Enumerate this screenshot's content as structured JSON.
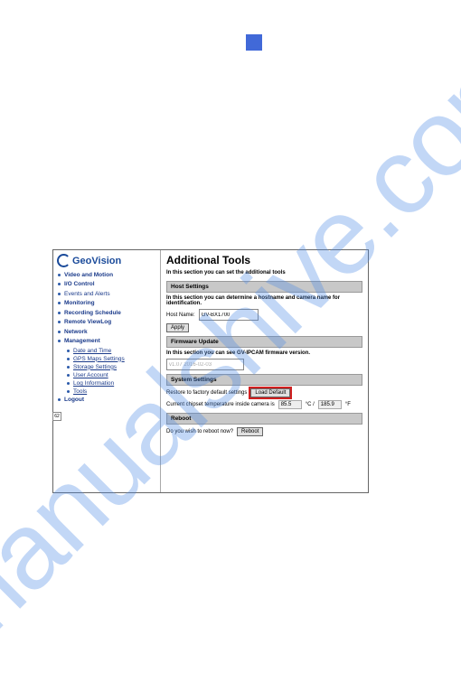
{
  "watermark": "manualshive.com",
  "page_num": "",
  "screenshot": {
    "logo": "GeoVision",
    "nav": [
      {
        "label": "Video and Motion",
        "bold": true
      },
      {
        "label": "I/O Control",
        "bold": true
      },
      {
        "label": "Events and Alerts",
        "bold": false
      },
      {
        "label": "Monitoring",
        "bold": true
      },
      {
        "label": "Recording Schedule",
        "bold": true
      },
      {
        "label": "Remote ViewLog",
        "bold": true
      },
      {
        "label": "Network",
        "bold": true
      },
      {
        "label": "Management",
        "bold": true
      }
    ],
    "subnav": [
      "Date and Time",
      "GPS Maps Settings",
      "Storage Settings",
      "User Account",
      "Log Information",
      "Tools"
    ],
    "logout": "Logout",
    "main": {
      "title": "Additional Tools",
      "intro": "In this section you can set the additional tools",
      "host_section": {
        "header": "Host Settings",
        "desc": "In this section you can determine a hostname and camera name for identification.",
        "label": "Host Name:",
        "value": "GV-BX1700",
        "apply": "Apply"
      },
      "firmware_section": {
        "header": "Firmware Update",
        "desc": "In this section you can see GV-IPCAM firmware version.",
        "value": "v1.07 2016-02-03"
      },
      "system_section": {
        "header": "System Settings",
        "restore_label": "Restore to factory default settings",
        "load_default": "Load Default",
        "temp_label": "Current chipset temperature inside camera is",
        "temp_c": "85.5",
        "temp_c_unit": "°C /",
        "temp_f": "185.9",
        "temp_f_unit": "°F"
      },
      "reboot_section": {
        "header": "Reboot",
        "label": "Do you wish to reboot now?",
        "button": "Reboot"
      }
    }
  },
  "corner_marker": "62"
}
